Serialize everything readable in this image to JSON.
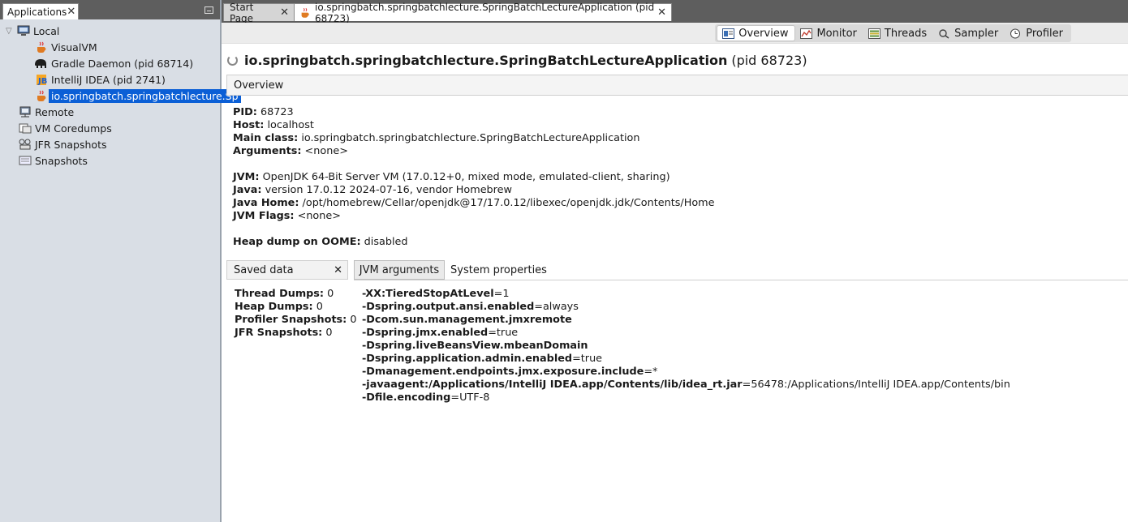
{
  "left_panel": {
    "tab_label": "Applications",
    "tree": {
      "local": "Local",
      "visualvm": "VisualVM",
      "gradle": "Gradle Daemon (pid 68714)",
      "intellij": "IntelliJ IDEA (pid 2741)",
      "app": "io.springbatch.springbatchlecture.Sp",
      "remote": "Remote",
      "coredumps": "VM Coredumps",
      "jfr": "JFR Snapshots",
      "snapshots": "Snapshots"
    }
  },
  "tabs": {
    "start": "Start Page",
    "app": "io.springbatch.springbatchlecture.SpringBatchLectureApplication (pid 68723)"
  },
  "views": {
    "overview": "Overview",
    "monitor": "Monitor",
    "threads": "Threads",
    "sampler": "Sampler",
    "profiler": "Profiler"
  },
  "title": {
    "name": "io.springbatch.springbatchlecture.SpringBatchLectureApplication",
    "pid": "(pid 68723)"
  },
  "overview_header": "Overview",
  "info": {
    "pid_label": "PID:",
    "pid": "68723",
    "host_label": "Host:",
    "host": "localhost",
    "main_label": "Main class:",
    "main": "io.springbatch.springbatchlecture.SpringBatchLectureApplication",
    "args_label": "Arguments:",
    "args": "<none>",
    "jvm_label": "JVM:",
    "jvm": "OpenJDK 64-Bit Server VM (17.0.12+0, mixed mode, emulated-client, sharing)",
    "java_label": "Java:",
    "java": "version 17.0.12 2024-07-16, vendor Homebrew",
    "home_label": "Java Home:",
    "home": "/opt/homebrew/Cellar/openjdk@17/17.0.12/libexec/openjdk.jdk/Contents/Home",
    "flags_label": "JVM Flags:",
    "flags": "<none>",
    "heap_label": "Heap dump on OOME:",
    "heap": "disabled"
  },
  "lower_tabs": {
    "saved": "Saved data",
    "jvm_args": "JVM arguments",
    "sys_props": "System properties"
  },
  "saved_data": {
    "thread_label": "Thread Dumps:",
    "thread": "0",
    "heap_label": "Heap Dumps:",
    "heap": "0",
    "profiler_label": "Profiler Snapshots:",
    "profiler": "0",
    "jfr_label": "JFR Snapshots:",
    "jfr": "0"
  },
  "jvm_args": [
    {
      "key": "-XX:TieredStopAtLevel",
      "val": "=1"
    },
    {
      "key": "-Dspring.output.ansi.enabled",
      "val": "=always"
    },
    {
      "key": "-Dcom.sun.management.jmxremote",
      "val": ""
    },
    {
      "key": "-Dspring.jmx.enabled",
      "val": "=true"
    },
    {
      "key": "-Dspring.liveBeansView.mbeanDomain",
      "val": ""
    },
    {
      "key": "-Dspring.application.admin.enabled",
      "val": "=true"
    },
    {
      "key": "-Dmanagement.endpoints.jmx.exposure.include",
      "val": "=*"
    },
    {
      "key": "-javaagent:/Applications/IntelliJ IDEA.app/Contents/lib/idea_rt.jar",
      "val": "=56478:/Applications/IntelliJ IDEA.app/Contents/bin"
    },
    {
      "key": "-Dfile.encoding",
      "val": "=UTF-8"
    }
  ]
}
